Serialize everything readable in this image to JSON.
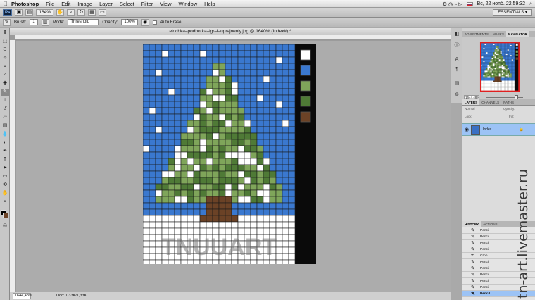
{
  "menubar": {
    "apple": "",
    "app_name": "Photoshop",
    "items": [
      "File",
      "Edit",
      "Image",
      "Layer",
      "Select",
      "Filter",
      "View",
      "Window",
      "Help"
    ],
    "datetime": "Вс, 22 нояб.  22:59:32"
  },
  "appbar": {
    "badge": "Ps",
    "zoom": "164%",
    "workspace": "ESSENTIALS ▾"
  },
  "options": {
    "brush_label": "Brush:",
    "brush_size": "1",
    "mode_label": "Mode:",
    "mode_value": "Threshold",
    "opacity_label": "Opacity:",
    "opacity_value": "100%",
    "auto_erase": "Auto Erase"
  },
  "document": {
    "title": "elochka–podborka–igr–i–uprajneniy.jpg @ 1640% (Index#) *",
    "status_zoom": "1644,48%",
    "status_info": "Doc: 1,33K/1,33K"
  },
  "artwork": {
    "watermark_text": "TNUUART",
    "colors": {
      "sky": "#3a78cf",
      "snow": "#ffffff",
      "light_green": "#7fa55a",
      "dark_green": "#4f7a36",
      "trunk": "#6b4226",
      "grid": "#1a1a1a",
      "palette_bg": "#0a0a0a"
    },
    "palette": [
      "#ffffff",
      "#3a78cf",
      "#7fa55a",
      "#4f7a36",
      "#6b4226"
    ]
  },
  "navigator": {
    "tabs": [
      "ADJUSTMENTS",
      "MASKS",
      "NAVIGATOR"
    ],
    "active_tab": "NAVIGATOR",
    "zoom": "1644,48%"
  },
  "layers": {
    "tabs": [
      "LAYERS",
      "CHANNELS",
      "PATHS"
    ],
    "active_tab": "LAYERS",
    "blend_mode": "Normal",
    "opacity_label": "Opacity:",
    "lock_label": "Lock:",
    "fill_label": "Fill:",
    "layer_name": "Index"
  },
  "history": {
    "tabs": [
      "HISTORY",
      "ACTIONS"
    ],
    "active_tab": "HISTORY",
    "items": [
      {
        "icon": "pencil-icon",
        "label": "Pencil",
        "selected": false
      },
      {
        "icon": "pencil-icon",
        "label": "Pencil",
        "selected": false
      },
      {
        "icon": "pencil-icon",
        "label": "Pencil",
        "selected": false
      },
      {
        "icon": "pencil-icon",
        "label": "Pencil",
        "selected": false
      },
      {
        "icon": "crop-icon",
        "label": "Crop",
        "selected": false
      },
      {
        "icon": "pencil-icon",
        "label": "Pencil",
        "selected": false
      },
      {
        "icon": "pencil-icon",
        "label": "Pencil",
        "selected": false
      },
      {
        "icon": "pencil-icon",
        "label": "Pencil",
        "selected": false
      },
      {
        "icon": "pencil-icon",
        "label": "Pencil",
        "selected": false
      },
      {
        "icon": "pencil-icon",
        "label": "Pencil",
        "selected": false
      },
      {
        "icon": "pencil-icon",
        "label": "Pencil",
        "selected": true
      }
    ]
  },
  "side_watermark": "tn-art.livemaster.ru"
}
